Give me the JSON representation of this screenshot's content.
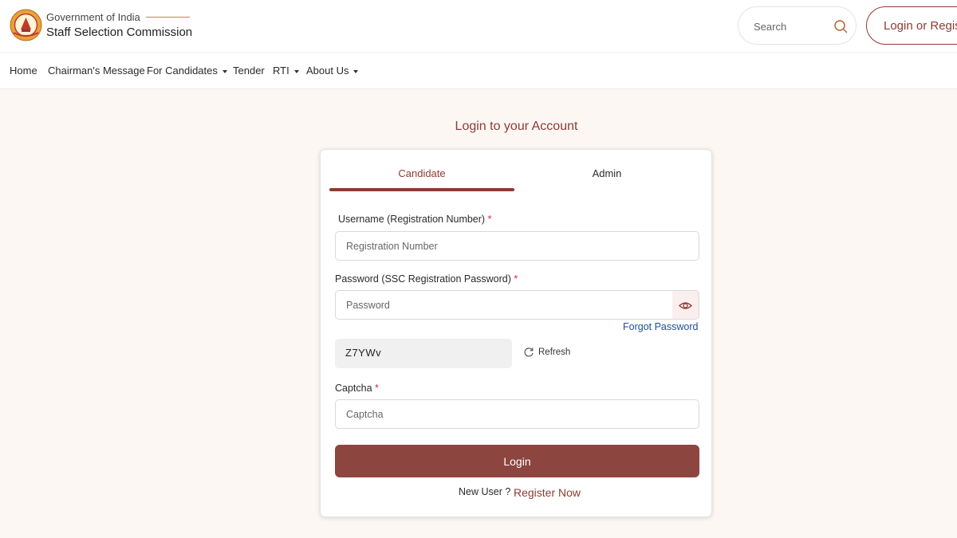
{
  "header": {
    "gov_text": "Government of India",
    "org_name": "Staff Selection Commission",
    "search_placeholder": "Search",
    "login_register_label": "Login or Register",
    "logo_icon": "ssc-emblem-icon",
    "search_icon": "search-icon"
  },
  "nav": {
    "items": [
      {
        "label": "Home",
        "dropdown": false
      },
      {
        "label": "Chairman's Message",
        "dropdown": false
      },
      {
        "label": "For Candidates",
        "dropdown": true
      },
      {
        "label": "Tender",
        "dropdown": false
      },
      {
        "label": "RTI",
        "dropdown": true
      },
      {
        "label": "About Us",
        "dropdown": true
      }
    ]
  },
  "login": {
    "title": "Login to your Account",
    "tabs": [
      {
        "label": "Candidate",
        "active": true
      },
      {
        "label": "Admin",
        "active": false
      }
    ],
    "username_label": "Username (Registration Number)",
    "username_placeholder": "Registration Number",
    "password_label": "Password (SSC Registration Password)",
    "password_placeholder": "Password",
    "required_marker": "*",
    "forgot_password": "Forgot Password",
    "captcha_code": "Z7YWv",
    "refresh_label": "Refresh",
    "captcha_label": "Captcha",
    "captcha_placeholder": "Captcha",
    "login_button": "Login",
    "new_user_text": "New User ?",
    "register_link": "Register Now"
  },
  "colors": {
    "accent": "#8d3b33",
    "button": "#8d4540",
    "link": "#1f4e99",
    "required": "#d32f2f",
    "page_bg": "#fdf7f4"
  }
}
